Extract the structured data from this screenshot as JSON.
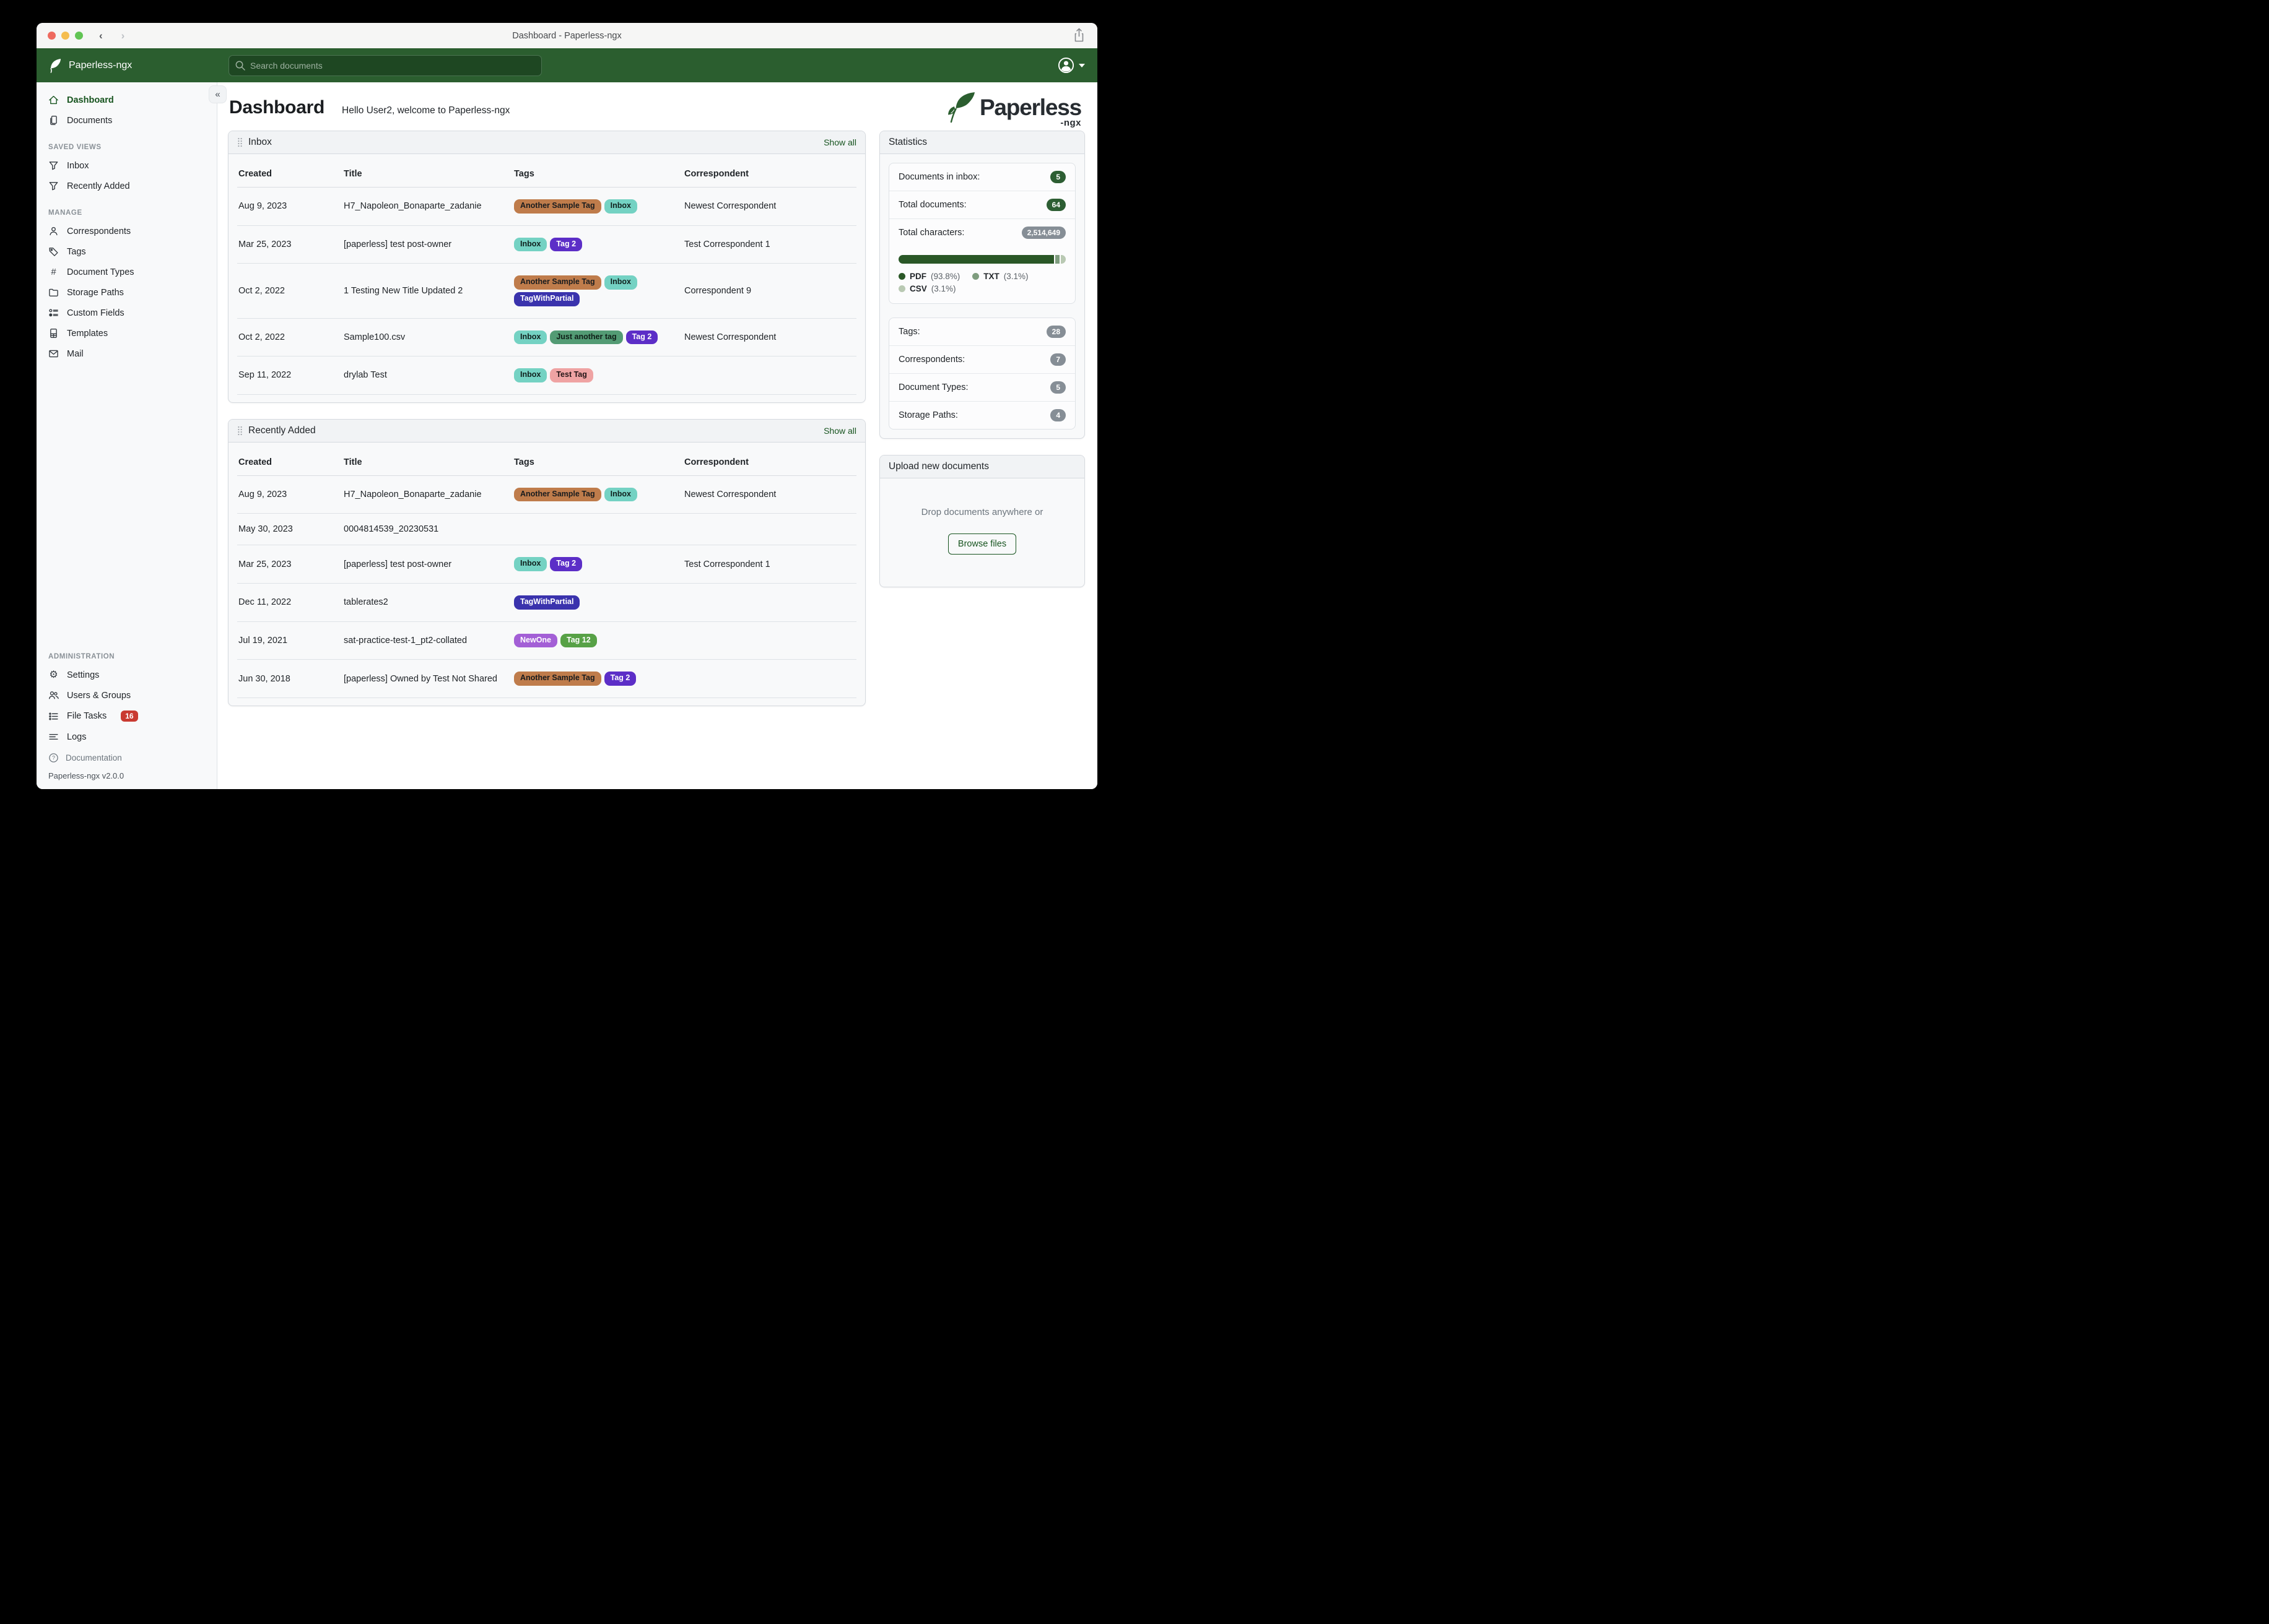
{
  "window": {
    "title": "Dashboard - Paperless-ngx"
  },
  "app_header": {
    "brand": "Paperless-ngx",
    "search_placeholder": "Search documents"
  },
  "sidebar": {
    "primary": [
      {
        "label": "Dashboard",
        "active": true
      },
      {
        "label": "Documents",
        "active": false
      }
    ],
    "saved_views": {
      "heading": "SAVED VIEWS",
      "items": [
        {
          "label": "Inbox"
        },
        {
          "label": "Recently Added"
        }
      ]
    },
    "manage": {
      "heading": "MANAGE",
      "items": [
        {
          "label": "Correspondents"
        },
        {
          "label": "Tags"
        },
        {
          "label": "Document Types"
        },
        {
          "label": "Storage Paths"
        },
        {
          "label": "Custom Fields"
        },
        {
          "label": "Templates"
        },
        {
          "label": "Mail"
        }
      ]
    },
    "administration": {
      "heading": "ADMINISTRATION",
      "items": [
        {
          "label": "Settings"
        },
        {
          "label": "Users & Groups"
        },
        {
          "label": "File Tasks",
          "badge": "16"
        },
        {
          "label": "Logs"
        }
      ]
    },
    "documentation": "Documentation",
    "version": "Paperless-ngx v2.0.0"
  },
  "page": {
    "title": "Dashboard",
    "greeting": "Hello User2, welcome to Paperless-ngx"
  },
  "logo": {
    "word": "Paperless",
    "suffix": "-ngx"
  },
  "tags": {
    "another_sample_tag": {
      "label": "Another Sample Tag",
      "bg": "#bf7c4b",
      "fg": "#181b1e"
    },
    "inbox": {
      "label": "Inbox",
      "bg": "#74d2c3",
      "fg": "#10201d"
    },
    "tag2": {
      "label": "Tag 2",
      "bg": "#5c2ec7",
      "fg": "#ffffff"
    },
    "tagwithpartial": {
      "label": "TagWithPartial",
      "bg": "#3a33ad",
      "fg": "#ffffff"
    },
    "just_another_tag": {
      "label": "Just another tag",
      "bg": "#539b74",
      "fg": "#0f1f17"
    },
    "test_tag": {
      "label": "Test Tag",
      "bg": "#efa3a3",
      "fg": "#231416"
    },
    "newone": {
      "label": "NewOne",
      "bg": "#a35fd6",
      "fg": "#ffffff"
    },
    "tag12": {
      "label": "Tag 12",
      "bg": "#57a146",
      "fg": "#ffffff"
    }
  },
  "inbox_widget": {
    "title": "Inbox",
    "show_all": "Show all",
    "columns": [
      "Created",
      "Title",
      "Tags",
      "Correspondent"
    ],
    "rows": [
      {
        "created": "Aug 9, 2023",
        "title": "H7_Napoleon_Bonaparte_zadanie",
        "tags": [
          "another_sample_tag",
          "inbox"
        ],
        "correspondent": "Newest Correspondent"
      },
      {
        "created": "Mar 25, 2023",
        "title": "[paperless] test post-owner",
        "tags": [
          "inbox",
          "tag2"
        ],
        "correspondent": "Test Correspondent 1"
      },
      {
        "created": "Oct 2, 2022",
        "title": "1 Testing New Title Updated 2",
        "tags": [
          "another_sample_tag",
          "inbox",
          "tagwithpartial"
        ],
        "correspondent": "Correspondent 9"
      },
      {
        "created": "Oct 2, 2022",
        "title": "Sample100.csv",
        "tags": [
          "inbox",
          "just_another_tag",
          "tag2"
        ],
        "correspondent": "Newest Correspondent"
      },
      {
        "created": "Sep 11, 2022",
        "title": "drylab Test",
        "tags": [
          "inbox",
          "test_tag"
        ],
        "correspondent": ""
      }
    ]
  },
  "recent_widget": {
    "title": "Recently Added",
    "show_all": "Show all",
    "columns": [
      "Created",
      "Title",
      "Tags",
      "Correspondent"
    ],
    "rows": [
      {
        "created": "Aug 9, 2023",
        "title": "H7_Napoleon_Bonaparte_zadanie",
        "tags": [
          "another_sample_tag",
          "inbox"
        ],
        "correspondent": "Newest Correspondent"
      },
      {
        "created": "May 30, 2023",
        "title": "0004814539_20230531",
        "tags": [],
        "correspondent": ""
      },
      {
        "created": "Mar 25, 2023",
        "title": "[paperless] test post-owner",
        "tags": [
          "inbox",
          "tag2"
        ],
        "correspondent": "Test Correspondent 1"
      },
      {
        "created": "Dec 11, 2022",
        "title": "tablerates2",
        "tags": [
          "tagwithpartial"
        ],
        "correspondent": ""
      },
      {
        "created": "Jul 19, 2021",
        "title": "sat-practice-test-1_pt2-collated",
        "tags": [
          "newone",
          "tag12"
        ],
        "correspondent": ""
      },
      {
        "created": "Jun 30, 2018",
        "title": "[paperless] Owned by Test Not Shared",
        "tags": [
          "another_sample_tag",
          "tag2"
        ],
        "correspondent": ""
      }
    ]
  },
  "statistics": {
    "title": "Statistics",
    "rows": [
      {
        "label": "Documents in inbox:",
        "value": "5",
        "variant": "green"
      },
      {
        "label": "Total documents:",
        "value": "64",
        "variant": "green"
      },
      {
        "label": "Total characters:",
        "value": "2,514,649",
        "variant": "gray"
      }
    ],
    "file_types_chart": {
      "type": "bar",
      "segments": [
        {
          "label": "PDF",
          "pct": 93.8,
          "color": "#2a5727"
        },
        {
          "label": "TXT",
          "pct": 3.1,
          "color": "#7f9d7f"
        },
        {
          "label": "CSV",
          "pct": 3.1,
          "color": "#b9c9b3"
        }
      ]
    },
    "counts": [
      {
        "label": "Tags:",
        "value": "28",
        "variant": "gray"
      },
      {
        "label": "Correspondents:",
        "value": "7",
        "variant": "gray"
      },
      {
        "label": "Document Types:",
        "value": "5",
        "variant": "gray"
      },
      {
        "label": "Storage Paths:",
        "value": "4",
        "variant": "gray"
      }
    ]
  },
  "upload": {
    "title": "Upload new documents",
    "hint": "Drop documents anywhere or",
    "button": "Browse files"
  },
  "colors": {
    "accent_green": "#17541f",
    "header_green": "#2b5e2f",
    "badge_green": "#2d5e33",
    "badge_gray": "#868e96",
    "task_badge_red": "#c93a31"
  }
}
